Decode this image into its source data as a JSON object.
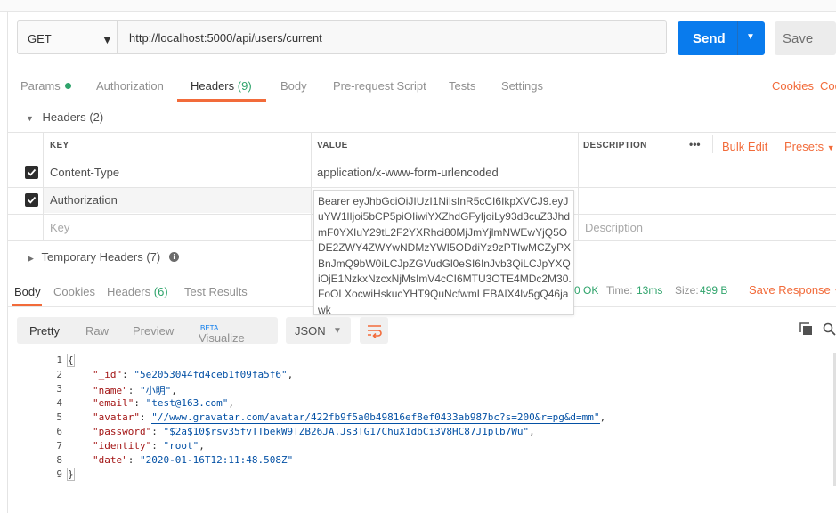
{
  "request": {
    "method": "GET",
    "url": "http://localhost:5000/api/users/current",
    "send_label": "Send",
    "save_label": "Save"
  },
  "request_tabs": {
    "params": "Params",
    "authorization": "Authorization",
    "headers": "Headers",
    "headers_count": "(9)",
    "body": "Body",
    "pre_request": "Pre-request Script",
    "tests": "Tests",
    "settings": "Settings",
    "cookies": "Cookies",
    "code": "Code"
  },
  "headers_section": {
    "title": "Headers",
    "count": "(2)",
    "col_key": "KEY",
    "col_value": "VALUE",
    "col_description": "DESCRIPTION",
    "more": "•••",
    "bulk_edit": "Bulk Edit",
    "presets": "Presets",
    "rows": [
      {
        "key": "Content-Type",
        "value": "application/x-www-form-urlencoded",
        "checked": true
      },
      {
        "key": "Authorization",
        "value": "Bearer",
        "checked": true
      }
    ],
    "placeholder_key": "Key",
    "placeholder_description": "Description",
    "tooltip_value": "Bearer eyJhbGciOiJIUzI1NiIsInR5cCI6IkpXVCJ9.eyJuYW1lIjoi5bCP5piOIiwiYXZhdGFyIjoiLy93d3cuZ3JhdmF0YXIuY29tL2F2YXRhci80MjJmYjlmNWEwYjQ5ODE2ZWY4ZWYwNDMzYWI5ODdiYz9zPTIwMCZyPXBnJmQ9bW0iLCJpZGVudGl0eSI6InJvb3QiLCJpYXQiOjE1NzkxNzcxNjMsImV4cCI6MTU3OTE4MDc2M30.FoOLXocwiHskucYHT9QuNcfwmLEBAIX4lv5gQ46jawk"
  },
  "temp_headers": {
    "title": "Temporary Headers",
    "count": "(7)",
    "info_icon": "i"
  },
  "response_tabs": {
    "body": "Body",
    "cookies": "Cookies",
    "headers": "Headers",
    "headers_count": "(6)",
    "test_results": "Test Results"
  },
  "response_meta": {
    "status": "0 OK",
    "time_label": "Time:",
    "time_value": "13ms",
    "size_label": "Size:",
    "size_value": "499 B",
    "save_response": "Save Response"
  },
  "viewer": {
    "pretty": "Pretty",
    "raw": "Raw",
    "preview": "Preview",
    "visualize": "Visualize",
    "beta": "BETA",
    "format": "JSON"
  },
  "code_lines": [
    "1",
    "2",
    "3",
    "4",
    "5",
    "6",
    "7",
    "8",
    "9"
  ],
  "json": {
    "open": "{",
    "close": "}",
    "fields": [
      {
        "key": "\"_id\"",
        "value": "\"5e2053044fd4ceb1f09fa5f6\"",
        "comma": ","
      },
      {
        "key": "\"name\"",
        "value": "\"小明\"",
        "comma": ","
      },
      {
        "key": "\"email\"",
        "value": "\"test@163.com\"",
        "comma": ","
      },
      {
        "key": "\"avatar\"",
        "value": "\"//www.gravatar.com/avatar/422fb9f5a0b49816ef8ef0433ab987bc?s=200&r=pg&d=mm\"",
        "comma": ","
      },
      {
        "key": "\"password\"",
        "value": "\"$2a$10$rsv35fvTTbekW9TZB26JA.Js3TG17ChuX1dbCi3V8HC87J1plb7Wu\"",
        "comma": ","
      },
      {
        "key": "\"identity\"",
        "value": "\"root\"",
        "comma": ","
      },
      {
        "key": "\"date\"",
        "value": "\"2020-01-16T12:11:48.508Z\"",
        "comma": ""
      }
    ]
  }
}
